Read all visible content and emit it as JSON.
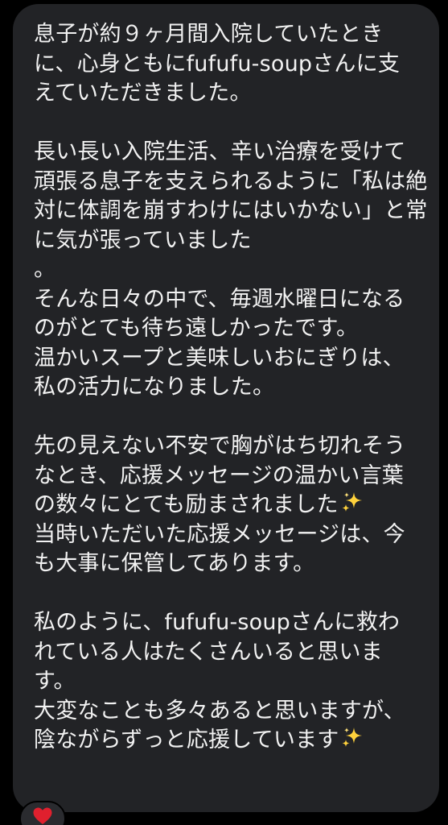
{
  "message": {
    "lines": [
      "息子が約９ヶ月間入院していたとき",
      "に、心身ともにfufufu-soupさんに支",
      "えていただきました。",
      "",
      "長い長い入院生活、辛い治療を受けて",
      "頑張る息子を支えられるように「私は絶",
      "対に体調を崩すわけにはいかない」と常",
      "に気が張っていました",
      "。",
      "そんな日々の中で、毎週水曜日になる",
      "のがとても待ち遠しかったです。",
      "温かいスープと美味しいおにぎりは、",
      "私の活力になりました。",
      "",
      "先の見えない不安で胸がはち切れそう",
      "なとき、応援メッセージの温かい言葉",
      "の数々にとても励まされました",
      "当時いただいた応援メッセージは、今",
      "も大事に保管してあります。",
      "",
      "私のように、fufufu-soupさんに救わ",
      "れている人はたくさんいると思いま",
      "す。",
      "大変なことも多々あると思いますが、",
      "陰ながらずっと応援しています"
    ],
    "sparkle_emoji_lines": [
      16,
      24
    ],
    "sparkle_icon": "sparkles-icon",
    "text_color": "#f2f2f2",
    "bubble_color": "#222326"
  },
  "reaction": {
    "icon": "heart-icon",
    "color": "#e0202e"
  }
}
